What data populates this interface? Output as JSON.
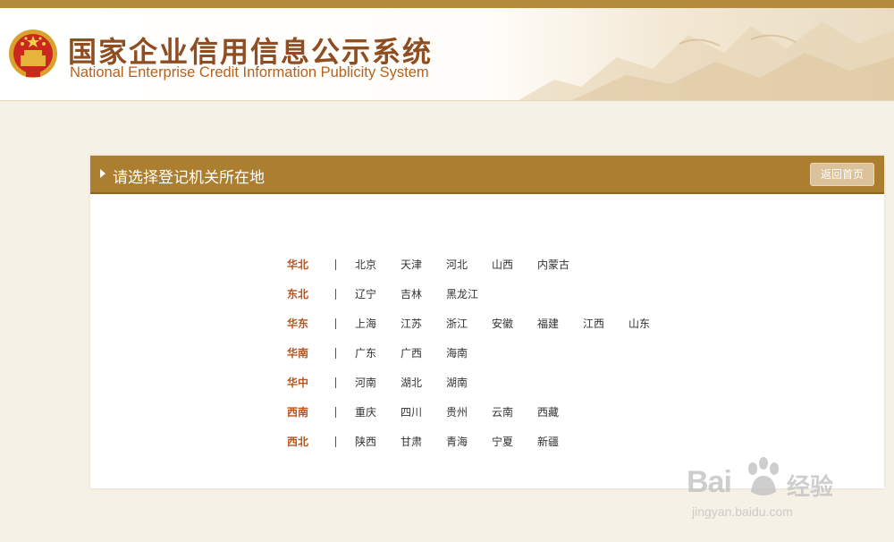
{
  "header": {
    "title_cn": "国家企业信用信息公示系统",
    "title_en": "National Enterprise Credit Information Publicity System"
  },
  "panel": {
    "title": "请选择登记机关所在地",
    "back_label": "返回首页"
  },
  "regions": [
    {
      "name": "华北",
      "provinces": [
        "北京",
        "天津",
        "河北",
        "山西",
        "内蒙古"
      ]
    },
    {
      "name": "东北",
      "provinces": [
        "辽宁",
        "吉林",
        "黑龙江"
      ]
    },
    {
      "name": "华东",
      "provinces": [
        "上海",
        "江苏",
        "浙江",
        "安徽",
        "福建",
        "江西",
        "山东"
      ]
    },
    {
      "name": "华南",
      "provinces": [
        "广东",
        "广西",
        "海南"
      ]
    },
    {
      "name": "华中",
      "provinces": [
        "河南",
        "湖北",
        "湖南"
      ]
    },
    {
      "name": "西南",
      "provinces": [
        "重庆",
        "四川",
        "贵州",
        "云南",
        "西藏"
      ]
    },
    {
      "name": "西北",
      "provinces": [
        "陕西",
        "甘肃",
        "青海",
        "宁夏",
        "新疆"
      ]
    }
  ],
  "watermark": {
    "logo": "Bai",
    "suffix": "经验",
    "url": "jingyan.baidu.com"
  },
  "colors": {
    "accent": "#ac7f30",
    "region_text": "#b8541d",
    "title_text": "#8f4e22"
  }
}
